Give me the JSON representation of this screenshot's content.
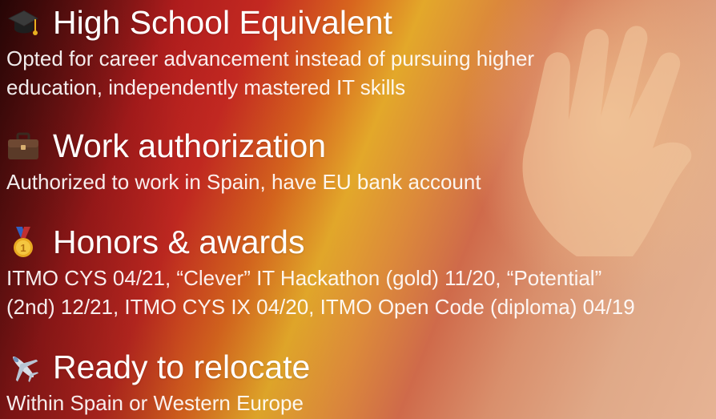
{
  "sections": [
    {
      "icon": "graduation-cap-icon",
      "title": "High School Equivalent",
      "lines": [
        "Opted for career advancement instead of pursuing higher",
        "education, independently mastered IT skills"
      ]
    },
    {
      "icon": "briefcase-icon",
      "title": "Work authorization",
      "lines": [
        "Authorized to work in Spain, have EU bank account"
      ]
    },
    {
      "icon": "medal-icon",
      "title": "Honors & awards",
      "lines": [
        "ITMO CYS 04/21, “Clever” IT Hackathon (gold) 11/20, “Potential”",
        "(2nd) 12/21, ITMO CYS IX 04/20, ITMO Open Code (diploma) 04/19"
      ]
    },
    {
      "icon": "airplane-icon",
      "title": "Ready to relocate",
      "lines": [
        "Within Spain or Western Europe"
      ]
    }
  ],
  "colors": {
    "text": "#ffffff",
    "background_red": "#c92a22",
    "background_yellow": "#e3a82a",
    "background_skin": "#e0a988"
  }
}
